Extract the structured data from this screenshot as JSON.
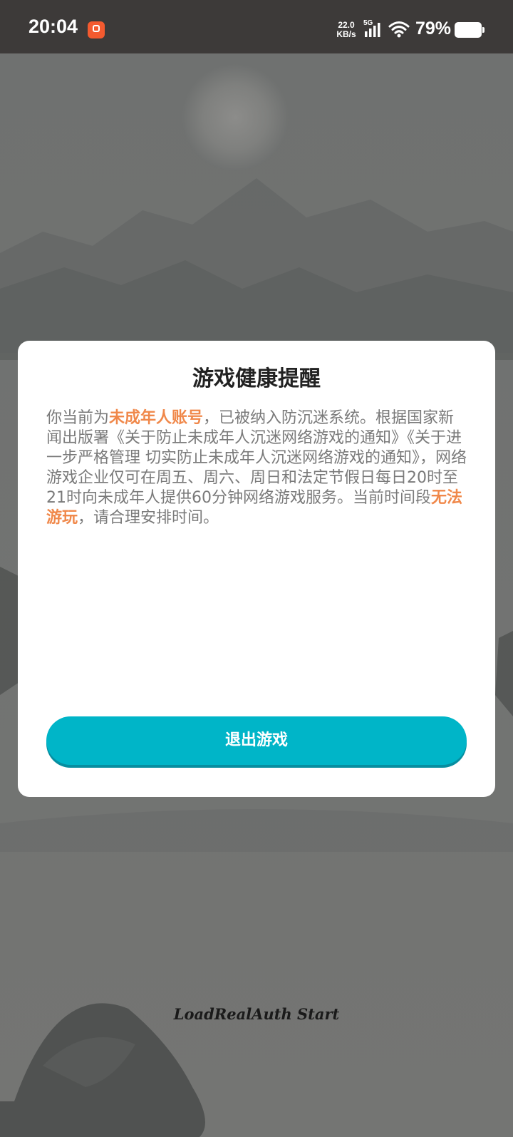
{
  "status_bar": {
    "time": "20:04",
    "net_speed_value": "22.0",
    "net_speed_unit": "KB/s",
    "network_type": "5G",
    "battery_percent": "79%"
  },
  "dialog": {
    "title": "游戏健康提醒",
    "body": {
      "part1": "你当前为",
      "highlight1": "未成年人账号",
      "part2": "，已被纳入防沉迷系统。根据国家新闻出版署《关于防止未成年人沉迷网络游戏的通知》《关于进一步严格管理 切实防止未成年人沉迷网络游戏的通知》，网络游戏企业仅可在周五、周六、周日和法定节假日每日20时至21时向未成年人提供60分钟网络游戏服务。当前时间段",
      "highlight2": "无法游玩",
      "part3": "，请合理安排时间。"
    },
    "exit_button_label": "退出游戏"
  },
  "load_status": "LoadRealAuth Start",
  "colors": {
    "accent": "#00b5c8",
    "highlight": "#f0884a",
    "overlay": "#6f7170"
  }
}
